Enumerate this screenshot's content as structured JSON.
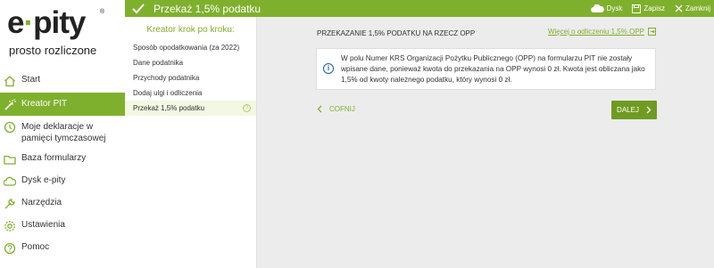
{
  "app": {
    "logo_main": "e",
    "logo_dot": "·",
    "logo_rest": "pity",
    "logo_reg": "®",
    "tagline": "prosto rozliczone"
  },
  "topbar": {
    "title": "Przekaż 1,5% podatku",
    "actions": {
      "disk": "Dysk",
      "save": "Zapisz",
      "close": "Zamknij"
    }
  },
  "sidebar": {
    "items": [
      {
        "label": "Start",
        "icon": "home-icon"
      },
      {
        "label": "Kreator PIT",
        "icon": "wand-icon",
        "active": true
      },
      {
        "label": "Moje deklaracje w pamięci tymczasowej",
        "icon": "history-icon"
      },
      {
        "label": "Baza formularzy",
        "icon": "folder-icon"
      },
      {
        "label": "Dysk e-pity",
        "icon": "cloud-icon"
      },
      {
        "label": "Narzędzia",
        "icon": "tools-icon"
      },
      {
        "label": "Ustawienia",
        "icon": "gear-icon"
      },
      {
        "label": "Pomoc",
        "icon": "help-icon"
      }
    ]
  },
  "wizard": {
    "title": "Kreator krok po kroku:",
    "steps": [
      "Sposób opodatkowania (za 2022)",
      "Dane podatnika",
      "Przychody podatnika",
      "Dodaj ulgi i odliczenia",
      "Przekaż 1,5% podatku"
    ],
    "help": "?"
  },
  "main": {
    "section_title": "PRZEKAZANIE 1,5% PODATKU NA RZECZ OPP",
    "more_link": "Więcej o odliczeniu 1,5% OPP",
    "info_icon": "i",
    "info_text": "W polu Numer KRS Organizacji Pożytku Publicznego (OPP) na formularzu PIT nie zostały wpisane dane, ponieważ kwota do przekazania na OPP wynosi 0 zł. Kwota jest obliczana jako 1,5% od kwoty należnego podatku, który wynosi 0 zł.",
    "back_label": "COFNIJ",
    "next_label": "DALEJ"
  },
  "colors": {
    "accent": "#7fb02d",
    "button": "#6f9b21",
    "info": "#1a5c9c"
  }
}
